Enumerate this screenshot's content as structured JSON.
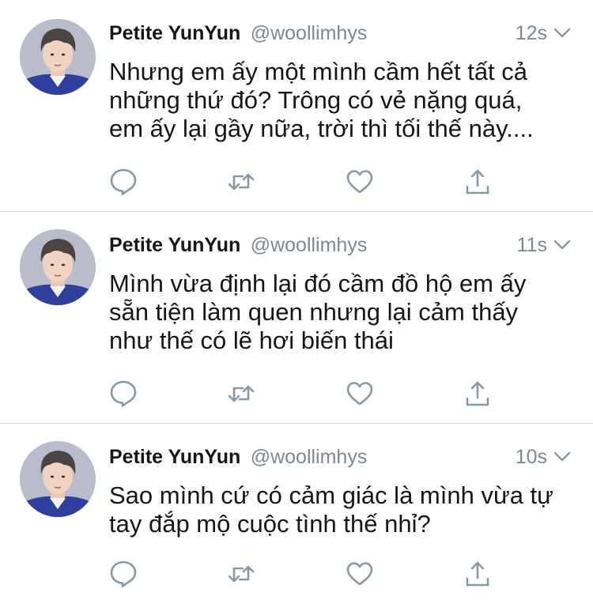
{
  "tweets": [
    {
      "display_name": "Petite YunYun",
      "handle": "@woollimhys",
      "time": "12s",
      "text": "Nhưng em ấy một mình cầm hết tất cả\nnhững thứ đó? Trông có vẻ nặng quá,\nem ấy lại gầy nữa, trời thì tối thế này...."
    },
    {
      "display_name": "Petite YunYun",
      "handle": "@woollimhys",
      "time": "11s",
      "text": "Mình vừa định lại đó cầm đồ hộ em ấy\nsẵn tiện làm quen nhưng lại cảm thấy\nnhư thế có lẽ hơi biến thái"
    },
    {
      "display_name": "Petite YunYun",
      "handle": "@woollimhys",
      "time": "10s",
      "text": "Sao mình cứ có cảm giác là mình vừa tự\ntay đắp mộ cuộc tình thế nhỉ?"
    }
  ],
  "icons": {
    "reply": "reply-icon",
    "retweet": "retweet-icon",
    "like": "heart-icon",
    "share": "share-icon",
    "menu": "chevron-down-icon"
  },
  "colors": {
    "text": "#14171a",
    "secondary": "#7c8893",
    "icon": "#8899a6",
    "divider": "#d8dde2",
    "avatar_uniform": "#2f3f9e"
  }
}
